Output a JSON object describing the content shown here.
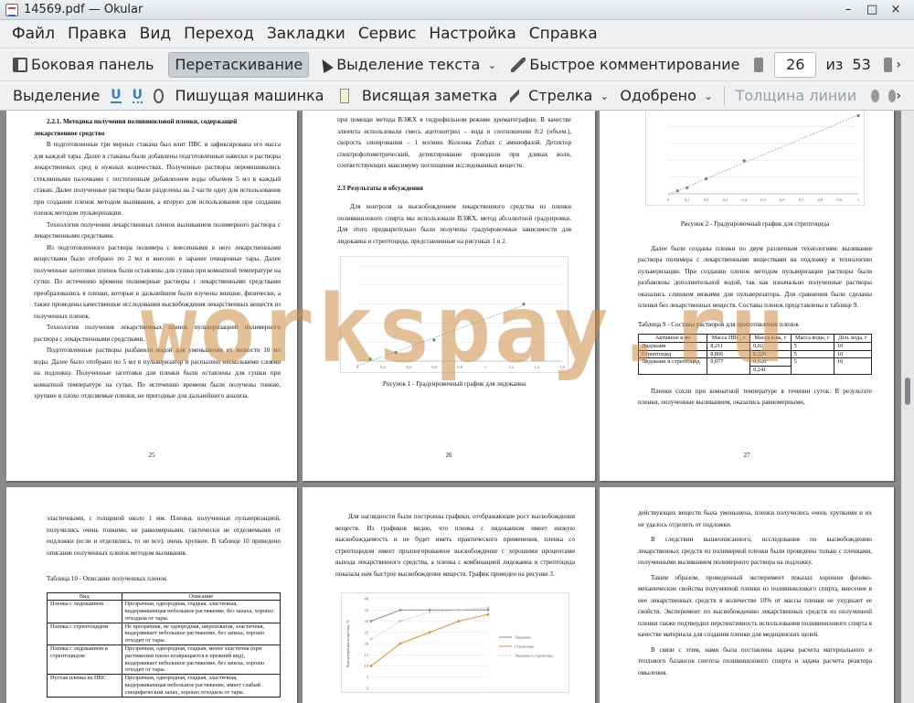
{
  "window": {
    "title": "14569.pdf — Okular"
  },
  "menubar": [
    "Файл",
    "Правка",
    "Вид",
    "Переход",
    "Закладки",
    "Сервис",
    "Настройка",
    "Справка"
  ],
  "toolbar1": {
    "sidebar": "Боковая панель",
    "drag": "Перетаскивание",
    "text_select": "Выделение текста",
    "quick_comment": "Быстрое комментирование",
    "page_current": "26",
    "page_of": "из",
    "page_total": "53"
  },
  "toolbar2": {
    "selection": "Выделение",
    "typewriter": "Пишущая машинка",
    "sticky_note": "Висящая заметка",
    "arrow": "Стрелка",
    "approved": "Одобрено",
    "line_width": "Толщина линии"
  },
  "watermark": "workspay.ru",
  "icons": [
    "app-icon",
    "panel-icon",
    "cursor-icon",
    "brush-icon",
    "page-up-icon",
    "page-down-icon",
    "underline-icon",
    "squiggle-icon",
    "stamp-icon",
    "note-icon",
    "pen-icon"
  ],
  "pages": {
    "p25": {
      "heading": "2.2.1. Методика получения поливиниловой пленки, содержащей лекарственное средство",
      "paras": [
        "В подготовленные три мерных стакана был влит ПВС и зафиксирована его масса для каждой тары. Далее в стаканы были добавлены подготовленные навески и растворы лекарственных сред в нужных количествах. Полученные растворы перемешивались стеклянными палочками с постепенным добавлением воды объемом 5 мл в каждый стакан. Далее полученные растворы были разделены на 2 части одну для использования при создании пленок методом выливания, а вторую для использования при создании пленок методом пульверизации.",
        "Технология получения лекарственных пленок выливанием полимерного раствора с лекарственными средствами.",
        "Из подготовленного раствора полимера с внесенными в него лекарственными веществами было отобрано по 2 мл и внесено в заранее очищенные тары. Далее полученные заготовки пленок были оставлены для сушки при комнатной температуре на сутки. По истечению времени полимерные растворы с лекарственными средствами преобразовались в пленки, которые в дальнейшем были изучены внешне, физически, а также проведены качественные исследования высвобождения лекарственных веществ из полученных пленок.",
        "Технология получения лекарственных пленок пульверизацией полимерного раствора с лекарственными средствами.",
        "Подготовленные растворы разбавили водой для уменьшения их вязкости 10 мл воды. Далее было отобрано по 5 мл в пульверизатор и распылено несколькими слоями на подложку. Полученные заготовки для пленки были оставлены для сушки при комнатной температуре на сутки. По истечению времени были получены тонкие, хрупкие и плохо отделяемые пленки, не пригодные для дальнейшего анализа."
      ],
      "number": "25"
    },
    "p26": {
      "paras_top": [
        "при помощи метода ВЭЖХ в гидрофильном режиме хроматографии. В качестве элюента использовали смесь ацетонитрил – вода в соотношении 8:2 (объем.), скорость элюирования – 1 мл/мин. Колонка Zorbax с аминофазой. Детектор спектрофотометрический, детектирование проводили при длинах волн, соответствующих максимуму поглощения исследованных веществ."
      ],
      "heading": "2.3 Результаты и обсуждения",
      "paras": [
        "Для контроля за высвобождением лекарственного средства из пленки поливинилового спирта мы использовали ВЭЖХ, метод абсолютной градуировки. Для этого предварительно были получены градуировочные зависимости для лидокаина и стрептоцида, представленные на рисунках 1 и 2."
      ],
      "caption": "Рисунок 1 - Градуировочный график для лидокаина",
      "number": "26"
    },
    "p27": {
      "caption": "Рисунок 2 - Градуировочный график для стрептоцида",
      "paras": [
        "Далее были созданы пленки по двум различным технологиям: выливания раствора полимера с лекарственными веществами на подложку и технологию пульверизации. При создании пленок методом пульверизации растворы были разбавлены дополнительной водой, так как изначально полученные растворы оказались слишком вязкими для пульверизатора. Для сравнения были сделаны пленки без лекарственных веществ. Составы пленок представлены в таблице 9."
      ],
      "table_title": "Таблица 9 - Составы растворов для приготовления пленок",
      "table_head": [
        "Активное в-во",
        "Масса ПВС, г",
        "Масса в-ва, г",
        "Масса воды, г",
        "Доп. вода, г"
      ],
      "table_rows": [
        [
          "Лидокаин",
          "8,211",
          "0,02",
          "5",
          "10"
        ],
        [
          "Стрептоцид",
          "8,806",
          "0,220",
          "5",
          "10"
        ],
        [
          "Лидокаин и стрептоцид",
          "9,077",
          "0,020",
          "5",
          "10"
        ],
        [
          "",
          "",
          "0,241",
          "",
          ""
        ]
      ],
      "para_end": "Пленки сохли при комнатной температуре в течении суток. В результате пленки, полученные выливанием, оказались равномерными,",
      "number": "27"
    },
    "p28": {
      "paras": [
        "эластичными, с толщиной около 1 мм. Пленки, полученные пульверизацией, получились очень тонкими, не равномерными, тактически не отделяемыми от подложки (если и отделялись, то не все), очень хрупкие. В таблице 10 приведено описание полученных пленок методом выливания."
      ],
      "table_title": "Таблица 10 - Описание полученных пленок",
      "table_head": [
        "Вид",
        "Описание"
      ],
      "table_rows": [
        [
          "Пленка с лидокаином",
          "Прозрачная, однородная, гладкая, эластичная, выдерживающая небольшое растяжение, без запаха, хорошо отходила от тары."
        ],
        [
          "Пленка с стрептоцидом",
          "Не прозрачная, не однородная, шероховатая, эластичная, выдерживает небольшое растяжение, без запаха, хорошо отходит от тары."
        ],
        [
          "Пленка с лидокаином и стрептоцидом",
          "Прозрачная, однородная, гладкая, менее эластична (при растяжении плохо возвращается в прежний вид), выдерживает небольшое растяжение, без запаха, хорошо отходит от тары."
        ],
        [
          "Пустая пленка из ПВС",
          "Прозрачная, однородная, гладкая, эластичная, выдерживающая небольшое растяжение, имеет слабый специфический запах, хорошо отходила от тары."
        ]
      ]
    },
    "p29": {
      "paras": [
        "Для наглядности были построены графики, отображающие рост высвобождения веществ. Из графиков видно, что пленка с лидокаином имеет низкую высвобождаемость и не будет иметь практического применения, пленка со стрептоцидом имеет пролонгированное высвобождение с хорошими процентами выхода лекарственного средства, а пленка с комбинацией лидокаина и стрептоцида показала нам быстрое высвобождение веществ. График приведен на рисунке 3."
      ],
      "legend": [
        "Лидокаин",
        "Стрептоцид",
        "Лидокаин и стрептоцид"
      ]
    },
    "p30": {
      "paras": [
        "действующих веществ была уменьшена, пленки получились очень хрупкими и их не удалось отделить от подложки.",
        "В следствии вышеописанного, исследования по высвобождению лекарственных средств из полимерной пленки были проведены только с пленками, полученными выливанием полимерного раствора на подложку.",
        "Таким образом, проведенный эксперимент показал хорошие физико-механические свойства полученной пленки из поливинилового спирта, внесение в нее лекарственных средств в количестве 10% от массы пленки не ухудшает ее свойств. Эксперимент по высвобождению лекарственных средств из полученной пленки также подтвердил перспективность использования поливинилового спирта в качестве материала для создания пленки для медицинских целей.",
        "В связи с этим, нами была поставлена задача расчета материального и теплового балансов синтеза поливинилового спирта и задача расчета реактора омыления."
      ]
    }
  },
  "chart_data": [
    {
      "type": "scatter",
      "title": "",
      "x": [
        0.1,
        0.3,
        0.6,
        1.3
      ],
      "y": [
        20,
        80,
        200,
        540
      ],
      "xlim": [
        0,
        1.6
      ],
      "ylim": [
        0,
        900
      ],
      "xticks": [
        "0",
        "0,2",
        "0,4",
        "0,6",
        "0,8",
        "1",
        "1,2",
        "1,4",
        "1,6"
      ]
    },
    {
      "type": "scatter",
      "title": "",
      "x": [
        0.05,
        0.1,
        0.2,
        0.4,
        1.0
      ],
      "y": [
        500,
        1000,
        2500,
        5500,
        13000
      ],
      "xlim": [
        0,
        1.0
      ],
      "ylim": [
        0,
        14000
      ],
      "xticks": [
        "0",
        "0,1",
        "0,2",
        "0,3",
        "0,4",
        "0,5",
        "0,6",
        "0,7",
        "0,8",
        "0,9",
        "1"
      ]
    },
    {
      "type": "line",
      "title": "",
      "ylabel": "Концентрация вещества, %",
      "x": [
        1,
        2,
        3,
        4,
        5
      ],
      "series": [
        {
          "name": "Лидокаин",
          "values": [
            30,
            35,
            35,
            35,
            35
          ]
        },
        {
          "name": "Стрептоцид",
          "values": [
            10,
            20,
            25,
            30,
            33
          ]
        },
        {
          "name": "Лидокаин и стрептоцид",
          "values": [
            22,
            30,
            34,
            35,
            36
          ]
        }
      ],
      "ylim": [
        0,
        40
      ],
      "yticks": [
        "0",
        "5",
        "10",
        "15",
        "20",
        "25",
        "30",
        "35",
        "40"
      ]
    }
  ]
}
